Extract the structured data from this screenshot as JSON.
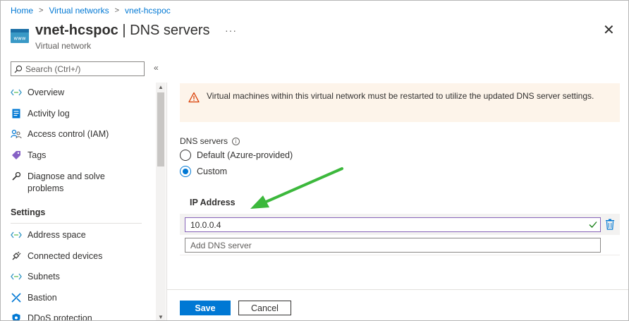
{
  "breadcrumb": {
    "items": [
      "Home",
      "Virtual networks",
      "vnet-hcspoc"
    ]
  },
  "header": {
    "resource_name": "vnet-hcspoc",
    "page_name": "| DNS servers",
    "subtitle": "Virtual network",
    "more_label": "···",
    "close_label": "✕",
    "icon_text": "www"
  },
  "sidebar": {
    "search_placeholder": "Search (Ctrl+/)",
    "collapse_label": "«",
    "items": [
      {
        "label": "Overview",
        "icon": "vnet-brackets-icon"
      },
      {
        "label": "Activity log",
        "icon": "activity-log-icon"
      },
      {
        "label": "Access control (IAM)",
        "icon": "people-icon"
      },
      {
        "label": "Tags",
        "icon": "tag-icon"
      },
      {
        "label": "Diagnose and solve problems",
        "icon": "wrench-icon"
      }
    ],
    "settings_header": "Settings",
    "settings_items": [
      {
        "label": "Address space",
        "icon": "vnet-brackets-icon"
      },
      {
        "label": "Connected devices",
        "icon": "plug-icon"
      },
      {
        "label": "Subnets",
        "icon": "vnet-brackets-icon"
      },
      {
        "label": "Bastion",
        "icon": "bastion-icon"
      },
      {
        "label": "DDoS protection",
        "icon": "shield-icon"
      }
    ]
  },
  "main": {
    "banner_text": "Virtual machines within this virtual network must be restarted to utilize the updated DNS server settings.",
    "dns_servers_label": "DNS servers",
    "radio_default": "Default (Azure-provided)",
    "radio_custom": "Custom",
    "selected": "Custom",
    "ip_header": "IP Address",
    "ip_value": "10.0.0.4",
    "add_placeholder": "Add DNS server",
    "save_label": "Save",
    "cancel_label": "Cancel"
  },
  "colors": {
    "accent": "#0078d4",
    "warning_bg": "#fdf4ea",
    "warning_icon": "#d83b01",
    "arrow": "#3cb83c"
  }
}
